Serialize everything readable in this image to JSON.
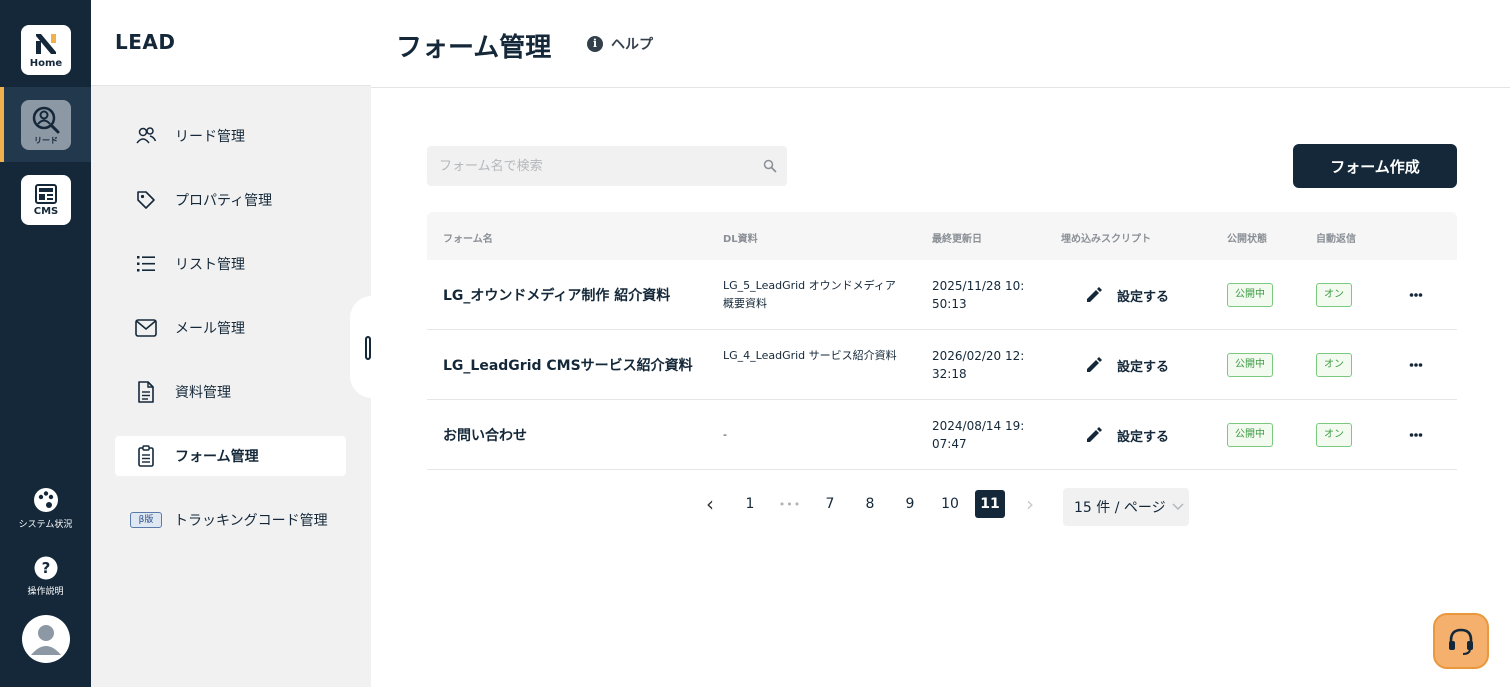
{
  "rail": {
    "home_label": "Home",
    "lead_label": "リード",
    "cms_label": "CMS",
    "system_label": "システム状況",
    "guide_label": "操作説明",
    "accent_color": "#f0b04c"
  },
  "sidebar": {
    "brand": "LEAD",
    "items": [
      {
        "label": "リード管理",
        "icon": "users-icon"
      },
      {
        "label": "プロパティ管理",
        "icon": "tag-icon"
      },
      {
        "label": "リスト管理",
        "icon": "list-icon"
      },
      {
        "label": "メール管理",
        "icon": "mail-icon"
      },
      {
        "label": "資料管理",
        "icon": "document-icon"
      },
      {
        "label": "フォーム管理",
        "icon": "form-icon",
        "active": true
      },
      {
        "label": "トラッキングコード管理",
        "badge": "β版"
      }
    ]
  },
  "header": {
    "title": "フォーム管理",
    "help_label": "ヘルプ"
  },
  "toolbar": {
    "search_placeholder": "フォーム名で検索",
    "create_label": "フォーム作成"
  },
  "table": {
    "columns": [
      "フォーム名",
      "DL資料",
      "最終更新日",
      "埋め込みスクリプト",
      "公開状態",
      "自動返信"
    ],
    "rows": [
      {
        "name": "LG_オウンドメディア制作 紹介資料",
        "dl": "LG_5_LeadGrid オウンドメディア概要資料",
        "date": "2025/11/28 10:50:13",
        "script": "設定する",
        "status": "公開中",
        "auto_reply": "オン"
      },
      {
        "name": "LG_LeadGrid CMSサービス紹介資料",
        "dl": "LG_4_LeadGrid サービス紹介資料",
        "date": "2026/02/20 12:32:18",
        "script": "設定する",
        "status": "公開中",
        "auto_reply": "オン"
      },
      {
        "name": "お問い合わせ",
        "dl": "-",
        "date": "2024/08/14 19:07:47",
        "script": "設定する",
        "status": "公開中",
        "auto_reply": "オン"
      }
    ]
  },
  "pagination": {
    "prev": "‹",
    "next": "›",
    "ellipsis": "•••",
    "pages": [
      "1",
      "7",
      "8",
      "9",
      "10",
      "11"
    ],
    "current": "11",
    "page_size": "15 件 / ページ"
  },
  "colors": {
    "navy": "#142839",
    "status_green": "#3c9a41",
    "support_orange": "#f5b06d"
  }
}
